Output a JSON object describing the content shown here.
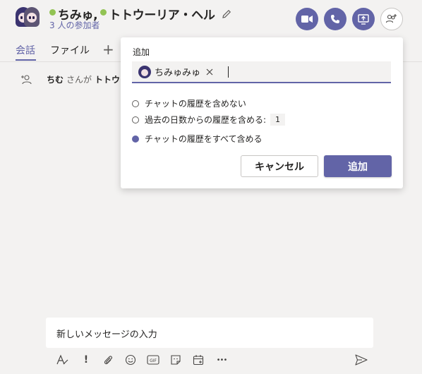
{
  "header": {
    "member1": "ちみゅ,",
    "member2": "トトウーリア・ヘル",
    "participants": "3 人の参加者"
  },
  "header_buttons": [
    {
      "icon": "video-call-icon"
    },
    {
      "icon": "audio-call-icon"
    },
    {
      "icon": "share-screen-icon"
    },
    {
      "icon": "add-people-icon"
    }
  ],
  "tabs": [
    {
      "label": "会話",
      "active": true
    },
    {
      "label": "ファイル",
      "active": false
    }
  ],
  "system_message": {
    "actor": "ちむ",
    "text": "さんが",
    "target": "トトウー"
  },
  "add_dialog": {
    "label": "追加",
    "chip_name": "ちみゅみゅ",
    "options": [
      {
        "label": "チャットの履歴を含めない",
        "checked": false
      },
      {
        "label": "過去の日数からの履歴を含める:",
        "checked": false,
        "days": "1"
      },
      {
        "label": "チャットの履歴をすべて含める",
        "checked": true
      }
    ],
    "cancel_label": "キャンセル",
    "add_label": "追加"
  },
  "compose": {
    "placeholder": "新しいメッセージの入力"
  },
  "toolbar": {
    "gif_label": "GIF",
    "more_label": "•••"
  },
  "colors": {
    "accent": "#6264a7",
    "presence": "#92c353",
    "background": "#f3f2f1"
  }
}
